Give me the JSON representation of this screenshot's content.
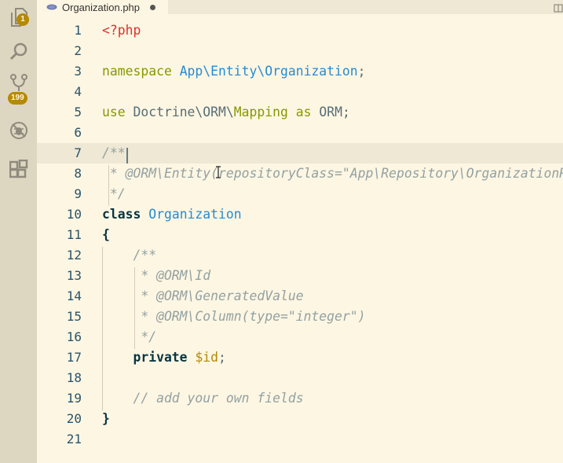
{
  "activity_bar": {
    "explorer_badge": "1",
    "source_control_badge": "199",
    "icons": [
      "files-icon",
      "search-icon",
      "source-control-icon",
      "debug-icon",
      "extensions-icon"
    ]
  },
  "tab": {
    "filename": "Organization.php",
    "file_icon": "php-icon",
    "dirty": true
  },
  "editor": {
    "line_numbers": [
      "1",
      "2",
      "3",
      "4",
      "5",
      "6",
      "7",
      "8",
      "9",
      "10",
      "11",
      "12",
      "13",
      "14",
      "15",
      "16",
      "17",
      "18",
      "19",
      "20",
      "21"
    ],
    "current_line": "7",
    "code": {
      "l1_open_tag": "<?php",
      "l3_keyword": "namespace",
      "l3_name": "App\\Entity\\Organization",
      "l3_semi": ";",
      "l5_use": "use",
      "l5_ns": "Doctrine\\ORM\\",
      "l5_mapping": "Mapping",
      "l5_as": "as",
      "l5_alias": "ORM;",
      "l7_doc": "/**",
      "l8_doc": " * @ORM\\Entity(repositoryClass=\"App\\Repository\\OrganizationRepository\")",
      "l9_doc": " */",
      "l10_class": "class",
      "l10_name": "Organization",
      "l11_brace": "{",
      "l12_doc": "    /**",
      "l13_doc": "     * @ORM\\Id",
      "l14_doc": "     * @ORM\\GeneratedValue",
      "l15_doc": "     * @ORM\\Column(type=\"integer\")",
      "l16_doc": "     */",
      "l17_private": "    private",
      "l17_var": "$id",
      "l17_semi": ";",
      "l19_comment": "    // add your own fields",
      "l20_brace": "}"
    }
  },
  "colors": {
    "background": "#fdf6e3",
    "activity_bar": "#ddd6c1",
    "badge": "#b58900",
    "keyword": "#859900",
    "namespace": "#268bd2",
    "php_tag": "#dc322f",
    "comment": "#93a1a1"
  }
}
